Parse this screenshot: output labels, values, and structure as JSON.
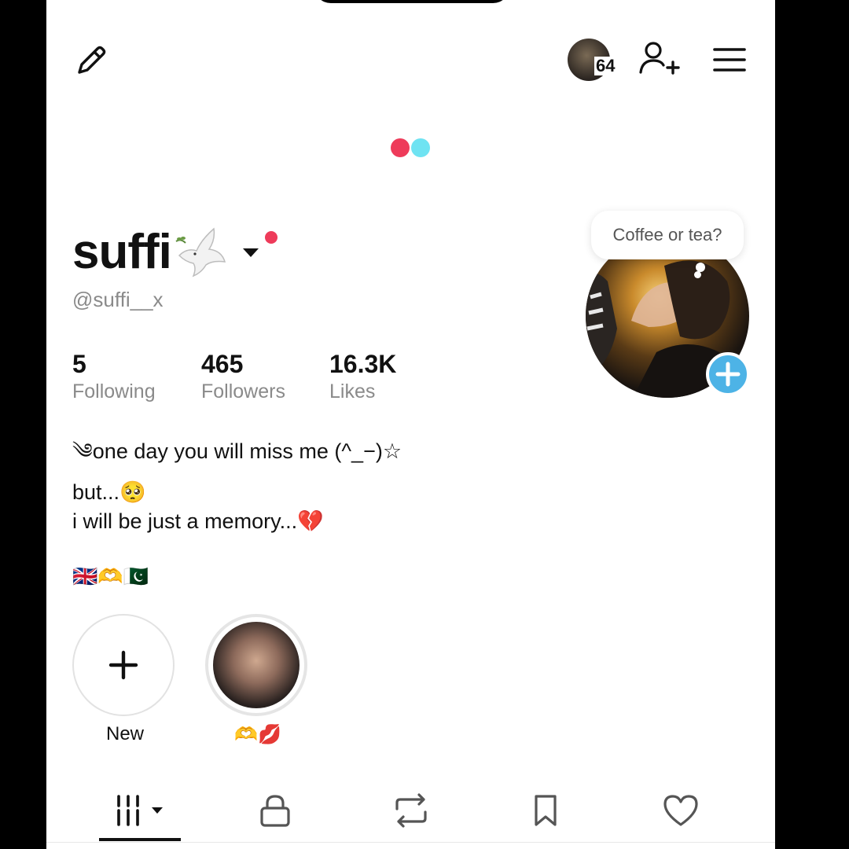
{
  "header": {
    "story_count": "64",
    "icons": [
      "pencil-icon",
      "friend-story-avatar",
      "add-friend-icon",
      "hamburger-menu-icon"
    ]
  },
  "profile": {
    "display_name": "suffi",
    "username": "@suffi__x",
    "stats": [
      {
        "value": "5",
        "label": "Following"
      },
      {
        "value": "465",
        "label": "Followers"
      },
      {
        "value": "16.3K",
        "label": "Likes"
      }
    ],
    "bio": {
      "line1": "༄one day you will miss me (^_−)☆",
      "line2": "but...🥺",
      "line3": "i will be just a memory...💔",
      "flags": "🇬🇧🫶🇵🇰"
    },
    "note_bubble": "Coffee or tea?"
  },
  "highlights": [
    {
      "label": "New"
    },
    {
      "label": "🫶💋"
    }
  ],
  "tabs": [
    "videos-grid-icon",
    "lock-icon",
    "repost-icon",
    "bookmark-icon",
    "heart-icon"
  ],
  "colors": {
    "accent_red": "#ee3b5a",
    "accent_cyan": "#6fe3f2",
    "add_blue": "#4db3e6",
    "secondary_text": "#8a8a8a"
  }
}
